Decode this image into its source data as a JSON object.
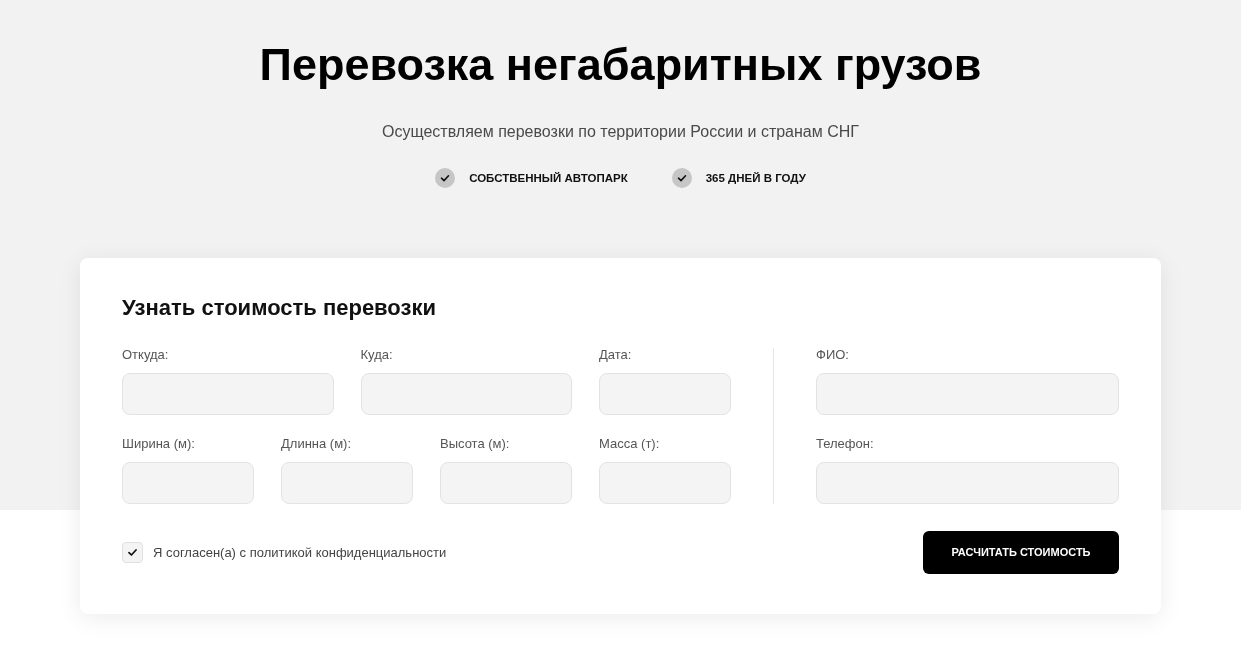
{
  "header": {
    "title": "Перевозка негабаритных грузов",
    "subtitle": "Осуществляем перевозки по территории России и странам СНГ",
    "features": [
      {
        "label": "СОБСТВЕННЫЙ АВТОПАРК"
      },
      {
        "label": "365 ДНЕЙ В ГОДУ"
      }
    ]
  },
  "form": {
    "title": "Узнать стоимость перевозки",
    "rows": [
      {
        "fields": [
          {
            "label": "Откуда:"
          },
          {
            "label": "Куда:"
          },
          {
            "label": "Дата:"
          }
        ]
      },
      {
        "fields": [
          {
            "label": "Ширина (м):"
          },
          {
            "label": "Длинна (м):"
          },
          {
            "label": "Высота (м):"
          },
          {
            "label": "Масса (т):"
          }
        ]
      }
    ],
    "contact_fields": [
      {
        "label": "ФИО:"
      },
      {
        "label": "Телефон:"
      }
    ],
    "consent": {
      "label": "Я согласен(а) с политикой конфиденциальности",
      "checked": true
    },
    "submit_button": "РАСЧИТАТЬ СТОИМОСТЬ"
  }
}
